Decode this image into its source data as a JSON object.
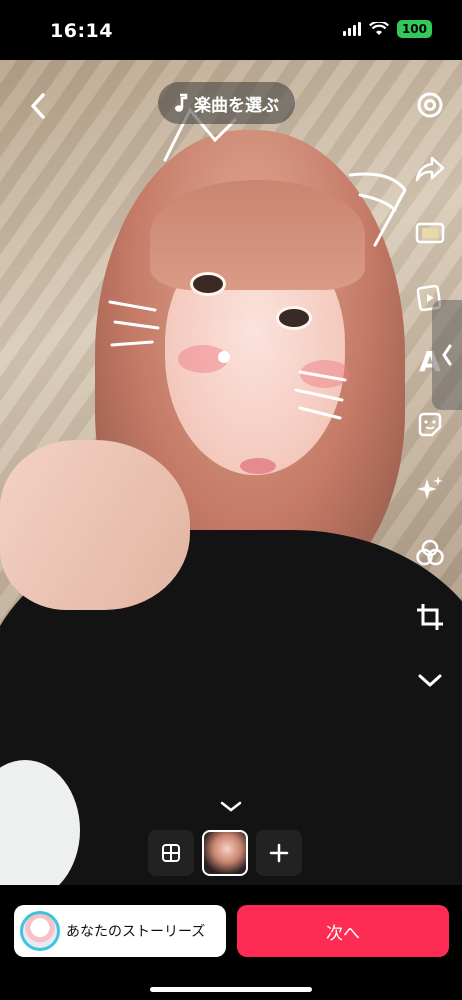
{
  "status_bar": {
    "time": "16:14",
    "battery": "100",
    "icons": [
      "signal-icon",
      "wifi-icon",
      "battery-icon"
    ]
  },
  "editor": {
    "music_label": "楽曲を選ぶ",
    "tools": [
      "settings-icon",
      "share-icon",
      "cut-icon",
      "stickers-video-icon",
      "text-icon",
      "sticker-icon",
      "effects-icon",
      "filters-icon",
      "crop-icon",
      "expand-more-icon"
    ],
    "text_tool_glyph": "A"
  },
  "bottom_bar": {
    "story_label": "あなたのストーリーズ",
    "next_label": "次へ",
    "accent": "#fe2c55",
    "story_ring": "#40c3dc"
  }
}
